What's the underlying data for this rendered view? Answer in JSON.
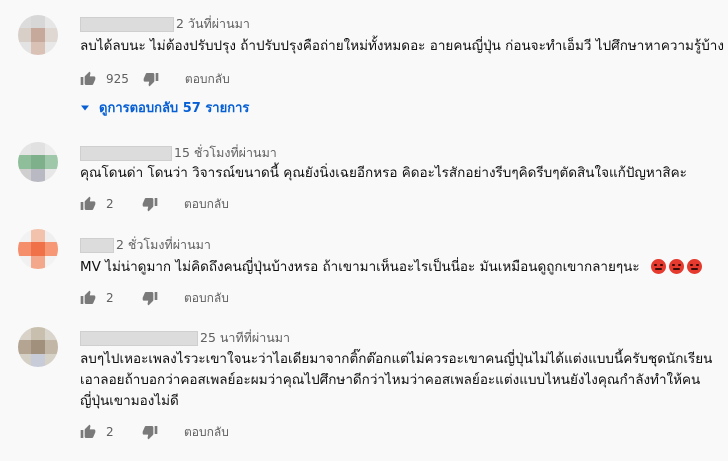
{
  "comments": [
    {
      "time": "2 วันที่ผ่านมา",
      "text_lines": [
        "ลบได้ลบนะ ไม่ต้องปรับปรุง ถ้าปรับปรุงคือถ่ายใหม่ทั้งหมดอะ อายคนญี่ปุ่น ก่อนจะทำเอ็มวี ไปศึกษาหาความรู้บ้าง"
      ],
      "likes": "925",
      "reply_label": "ตอบกลับ",
      "replies_link": "ดูการตอบกลับ 57 รายการ",
      "avatar_colors": [
        "#dcdcdc",
        "#d7d7d7",
        "#e6e6e6",
        "#d9cfc9",
        "#c7a99b",
        "#ded7d2",
        "#e3e3e3",
        "#d9c1b6",
        "#e8e8e8"
      ]
    },
    {
      "time": "15 ชั่วโมงที่ผ่านมา",
      "text_lines": [
        "คุณโดนด่า โดนว่า วิจารณ์ขนาดนี้ คุณยังนิ่งเฉยอีกหรอ คิดอะไรสักอย่างรีบๆคิดรีบๆตัดสินใจแก้ปัญหาสิคะ"
      ],
      "likes": "2",
      "reply_label": "ตอบกลับ",
      "avatar_colors": [
        "#e5e5e5",
        "#e1e1e1",
        "#ececec",
        "#8fbf9a",
        "#7eb08b",
        "#9fc7aa",
        "#cfcfcf",
        "#b9b9c3",
        "#e7e7e7"
      ]
    },
    {
      "time": "2 ชั่วโมงที่ผ่านมา",
      "text_lines": [
        "MV ไม่น่าดูมาก ไม่คิดถึงคนญี่ปุ่นบ้างหรอ ถ้าเขามาเห็นอะไรเป็นนี่อะ มันเหมือนดูถูกเขากลายๆนะ"
      ],
      "emoji_count": 3,
      "emoji_name": "angry-face-emoji",
      "likes": "2",
      "reply_label": "ตอบกลับ",
      "avatar_colors": [
        "#f2f2f2",
        "#f3c2ad",
        "#efefef",
        "#f58f6b",
        "#f07048",
        "#f69875",
        "#f1f1f1",
        "#f4a88b",
        "#f3f3f3"
      ]
    },
    {
      "time": "25 นาทีที่ผ่านมา",
      "text_lines": [
        "ลบๆไปเหอะเพลงไรวะเขาใจนะว่าไอเดียมาจากติ๊กต๊อกแต่ไม่ควรอะเขาคนญี่ปุ่นไม่ได้แต่งแบบนี้ครับชุดนักเรียน",
        "เอาลอยถ้าบอกว่าคอสเพลย์อะผมว่าคุณไปศึกษาดีกว่าไหมว่าคอสเพลย์อะแต่งแบบไหนยังไงคุณกำลังทำให้คน",
        "ญี่ปุ่นเขามองไม่ดี"
      ],
      "likes": "2",
      "reply_label": "ตอบกลับ",
      "avatar_colors": [
        "#d8d2c8",
        "#c9bfae",
        "#dad5cc",
        "#b3a592",
        "#a1917c",
        "#c2b7a6",
        "#d5d0c6",
        "#c8cbd8",
        "#d7d2c8"
      ]
    }
  ],
  "colors": {
    "link_blue": "#065fd4",
    "meta_gray": "#606060",
    "text": "#0f0f0f",
    "background": "#f9f9f9"
  }
}
